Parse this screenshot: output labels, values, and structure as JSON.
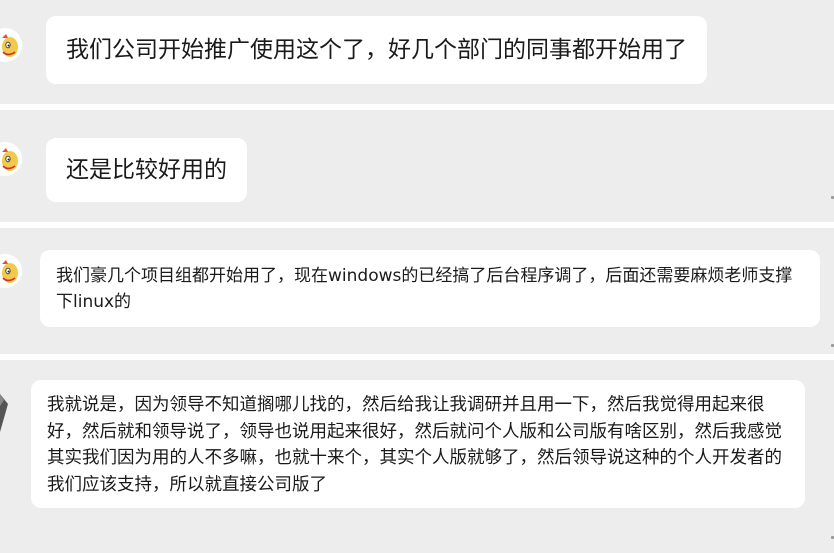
{
  "messages": [
    {
      "text": "我们公司开始推广使用这个了，好几个部门的同事都开始用了"
    },
    {
      "text": "还是比较好用的"
    },
    {
      "text": "我们豪几个项目组都开始用了，现在windows的已经搞了后台程序调了，后面还需要麻烦老师支撑下linux的"
    },
    {
      "text": "我就说是，因为领导不知道搁哪儿找的，然后给我让我调研并且用一下，然后我觉得用起来很好，然后就和领导说了，领导也说用起来很好，然后就问个人版和公司版有啥区别，然后我感觉其实我们因为用的人不多嘛，也就十来个，其实个人版就够了，然后领导说这种的个人开发者的我们应该支持，所以就直接公司版了"
    }
  ],
  "colors": {
    "background": "#ededed",
    "bubble": "#ffffff",
    "text": "#1a1a1a"
  }
}
